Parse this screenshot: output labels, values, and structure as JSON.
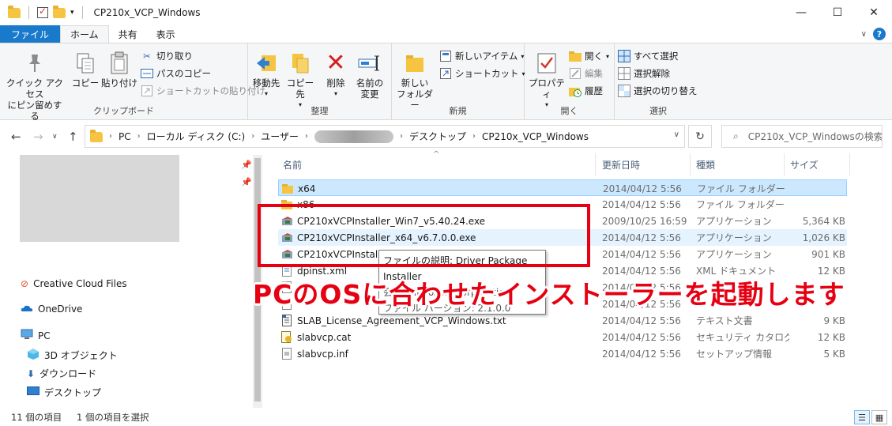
{
  "window": {
    "title": "CP210x_VCP_Windows",
    "minimize": "—",
    "maximize": "☐",
    "close": "✕"
  },
  "tabs": {
    "file": "ファイル",
    "home": "ホーム",
    "share": "共有",
    "view": "表示"
  },
  "ribbon": {
    "clipboard": {
      "label": "クリップボード",
      "pin_quick": "クイック アクセス\nにピン留めする",
      "copy": "コピー",
      "paste": "貼り付け",
      "cut": "切り取り",
      "copy_path": "パスのコピー",
      "paste_shortcut": "ショートカットの貼り付け"
    },
    "organize": {
      "label": "整理",
      "move_to": "移動先",
      "copy_to": "コピー先",
      "delete": "削除",
      "rename": "名前の\n変更"
    },
    "new": {
      "label": "新規",
      "new_folder": "新しい\nフォルダー",
      "new_item": "新しいアイテム",
      "easy_access": "ショートカット"
    },
    "open": {
      "label": "開く",
      "properties": "プロパティ",
      "open": "開く",
      "edit": "編集",
      "history": "履歴"
    },
    "select": {
      "label": "選択",
      "select_all": "すべて選択",
      "select_none": "選択解除",
      "invert": "選択の切り替え"
    }
  },
  "address": {
    "crumbs": [
      "PC",
      "ローカル ディスク (C:)",
      "ユーザー",
      "",
      "デスクトップ",
      "CP210x_VCP_Windows"
    ],
    "search_placeholder": "CP210x_VCP_Windowsの検索"
  },
  "nav": {
    "items": [
      {
        "label": "Creative Cloud Files",
        "icon": "creative-cloud-icon"
      },
      {
        "label": "OneDrive",
        "icon": "onedrive-icon"
      },
      {
        "label": "PC",
        "icon": "pc-icon"
      },
      {
        "label": "3D オブジェクト",
        "icon": "3d-objects-icon"
      },
      {
        "label": "ダウンロード",
        "icon": "download-icon"
      },
      {
        "label": "デスクトップ",
        "icon": "desktop-icon"
      }
    ]
  },
  "columns": {
    "name": "名前",
    "date": "更新日時",
    "type": "種類",
    "size": "サイズ"
  },
  "files": [
    {
      "name": "x64",
      "date": "2014/04/12 5:56",
      "type": "ファイル フォルダー",
      "size": "",
      "icon": "folder-icon"
    },
    {
      "name": "x86",
      "date": "2014/04/12 5:56",
      "type": "ファイル フォルダー",
      "size": "",
      "icon": "folder-icon"
    },
    {
      "name": "CP210xVCPInstaller_Win7_v5.40.24.exe",
      "date": "2009/10/25 16:59",
      "type": "アプリケーション",
      "size": "5,364 KB",
      "icon": "installer-icon"
    },
    {
      "name": "CP210xVCPInstaller_x64_v6.7.0.0.exe",
      "date": "2014/04/12 5:56",
      "type": "アプリケーション",
      "size": "1,026 KB",
      "icon": "installer-icon"
    },
    {
      "name": "CP210xVCPInstaller_x86_v6.7.0.0.exe",
      "date": "2014/04/12 5:56",
      "type": "アプリケーション",
      "size": "901 KB",
      "icon": "installer-icon"
    },
    {
      "name": "dpinst.xml",
      "date": "2014/04/12 5:56",
      "type": "XML ドキュメント",
      "size": "12 KB",
      "icon": "xml-icon"
    },
    {
      "name": "",
      "date": "2014/04/12 5:56",
      "type": "",
      "size": "",
      "icon": "file-icon"
    },
    {
      "name": "",
      "date": "2014/04/12 5:56",
      "type": "",
      "size": "",
      "icon": "file-icon"
    },
    {
      "name": "SLAB_License_Agreement_VCP_Windows.txt",
      "date": "2014/04/12 5:56",
      "type": "テキスト文書",
      "size": "9 KB",
      "icon": "text-file-icon"
    },
    {
      "name": "slabvcp.cat",
      "date": "2014/04/12 5:56",
      "type": "セキュリティ カタログ",
      "size": "12 KB",
      "icon": "catalog-icon"
    },
    {
      "name": "slabvcp.inf",
      "date": "2014/04/12 5:56",
      "type": "セットアップ情報",
      "size": "5 KB",
      "icon": "inf-icon"
    }
  ],
  "tooltip": {
    "description": "ファイルの説明: Driver Package Installer",
    "company": "会社: Microsoft Corporation",
    "version": "ファイル バージョン: 2.1.0.0"
  },
  "annotation": "PCのOSに合わせたインストーラーを起動します",
  "status": {
    "count": "11 個の項目",
    "selected": "1 個の項目を選択"
  },
  "colors": {
    "accent": "#1979ca",
    "selection": "#cce8ff",
    "annotation": "#e60012"
  }
}
